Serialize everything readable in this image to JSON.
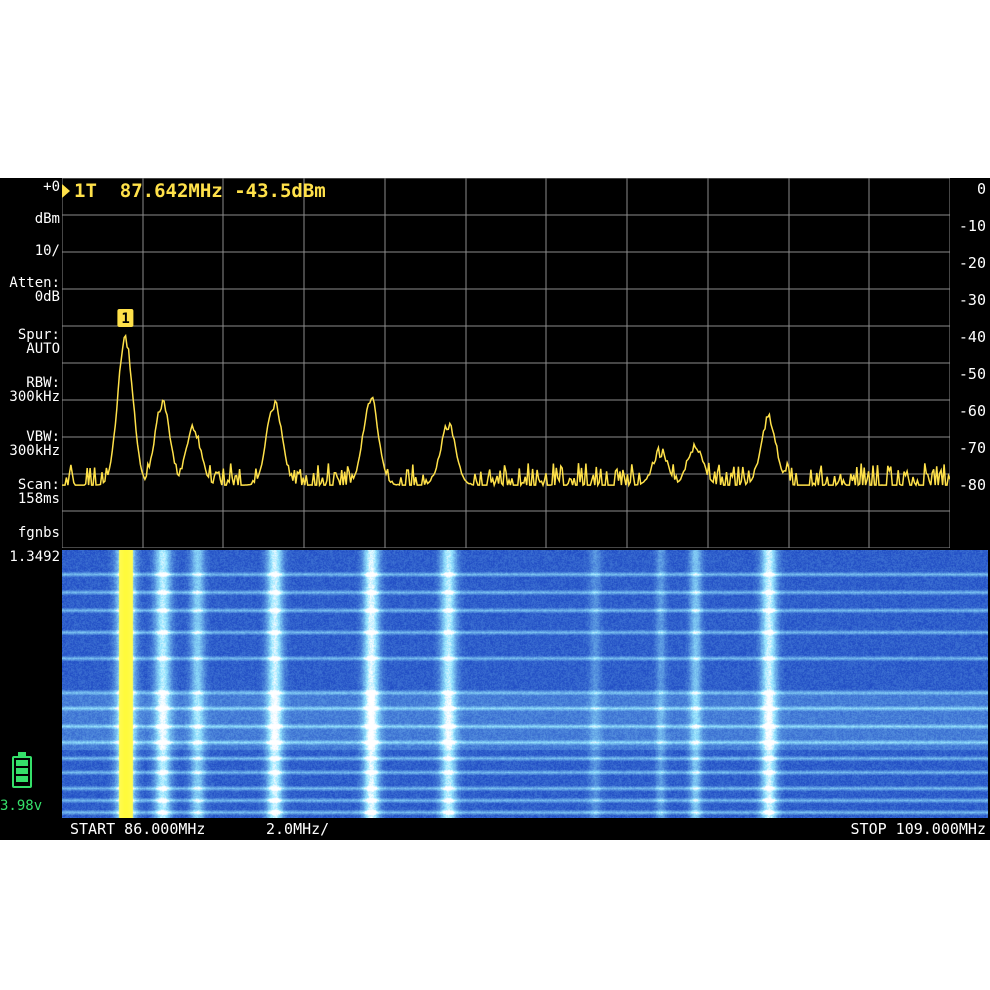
{
  "marker": {
    "label": "1T",
    "frequency": "87.642MHz",
    "level": "-43.5dBm",
    "tag": "1"
  },
  "sidebar": {
    "ref_level": "+0",
    "unit": "dBm",
    "scale": "10/",
    "atten_label": "Atten:",
    "atten_value": "0dB",
    "spur_label": "Spur:",
    "spur_value": "AUTO",
    "rbw_label": "RBW:",
    "rbw_value": "300kHz",
    "vbw_label": "VBW:",
    "vbw_value": "300kHz",
    "scan_label": "Scan:",
    "scan_value": "158ms",
    "mode_label": "fgnbs",
    "mode_value": "1.3492",
    "battery_voltage": "3.98v"
  },
  "y_axis": [
    "0",
    "-10",
    "-20",
    "-30",
    "-40",
    "-50",
    "-60",
    "-70",
    "-80"
  ],
  "footer": {
    "start": "START 86.000MHz",
    "div": "2.0MHz/",
    "stop": "STOP 109.000MHz"
  },
  "colors": {
    "trace": "#ffe14a",
    "grid": "#8c8c8c",
    "text": "#ffffff",
    "battery": "#35e06a",
    "waterfall_base": "#1742c8",
    "waterfall_peak": "#ffffff"
  },
  "chart_data": {
    "type": "line",
    "x_range": [
      86.0,
      109.0
    ],
    "ylim": [
      -90,
      0
    ],
    "peaks": [
      {
        "freq": 87.642,
        "dbm": -43.5
      },
      {
        "freq": 88.6,
        "dbm": -61
      },
      {
        "freq": 89.4,
        "dbm": -68
      },
      {
        "freq": 91.5,
        "dbm": -61
      },
      {
        "freq": 94.0,
        "dbm": -60
      },
      {
        "freq": 96.0,
        "dbm": -67
      },
      {
        "freq": 101.5,
        "dbm": -74
      },
      {
        "freq": 102.4,
        "dbm": -72
      },
      {
        "freq": 104.3,
        "dbm": -65
      }
    ],
    "noise_floor_dbm": -83
  }
}
